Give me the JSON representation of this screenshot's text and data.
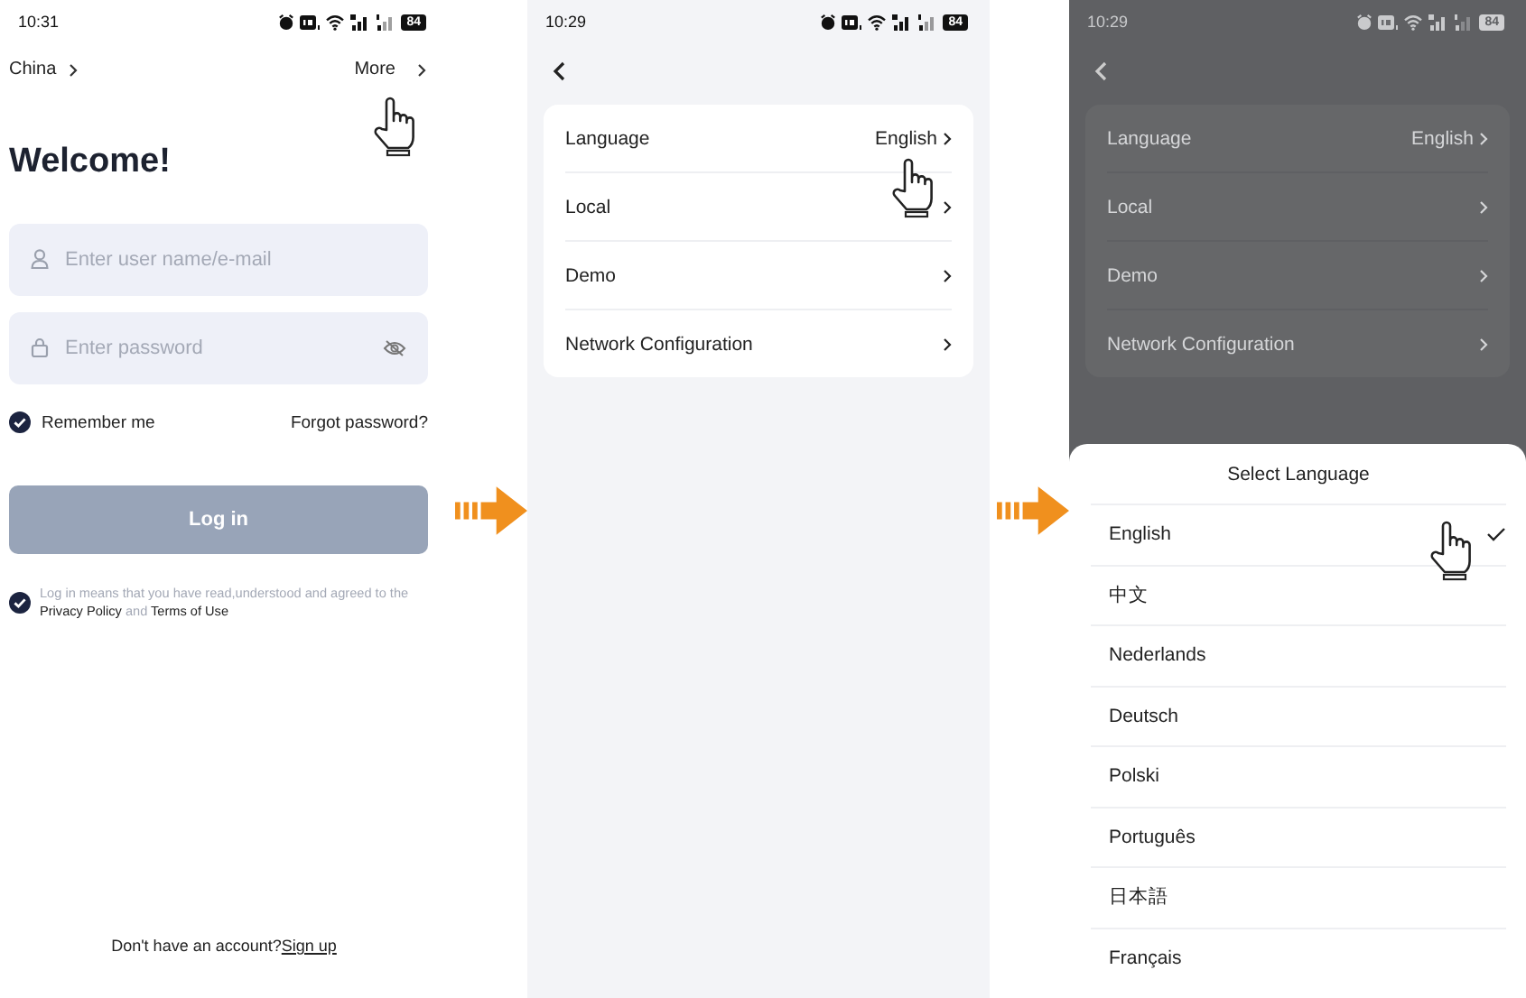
{
  "login_screen": {
    "status_bar": {
      "time": "10:31",
      "battery": "84"
    },
    "region": "China",
    "more": "More",
    "title": "Welcome!",
    "username_field": {
      "placeholder": "Enter user name/e-mail"
    },
    "password_field": {
      "placeholder": "Enter password"
    },
    "remember_me": {
      "label": "Remember me",
      "checked": true
    },
    "forgot_password": "Forgot password?",
    "login_button": "Log in",
    "agreement": {
      "checked": true,
      "text_before": "Log in means that you have read,understood and agreed to the ",
      "privacy_link": "Privacy Policy",
      "text_between": " and ",
      "terms_link": "Terms of Use"
    },
    "footer": {
      "text": "Don't have an account?",
      "link": "Sign up"
    }
  },
  "settings_screen": {
    "status_bar": {
      "time": "10:29",
      "battery": "84"
    },
    "items": [
      {
        "label": "Language",
        "value": "English"
      },
      {
        "label": "Local"
      },
      {
        "label": "Demo"
      },
      {
        "label": "Network Configuration"
      }
    ]
  },
  "language_screen": {
    "status_bar": {
      "time": "10:29",
      "battery": "84"
    },
    "items": [
      {
        "label": "Language",
        "value": "English"
      },
      {
        "label": "Local"
      },
      {
        "label": "Demo"
      },
      {
        "label": "Network Configuration"
      }
    ],
    "sheet": {
      "title": "Select Language",
      "options": [
        {
          "label": "English",
          "selected": true
        },
        {
          "label": "中文",
          "selected": false
        },
        {
          "label": "Nederlands",
          "selected": false
        },
        {
          "label": "Deutsch",
          "selected": false
        },
        {
          "label": "Polski",
          "selected": false
        },
        {
          "label": "Português",
          "selected": false
        },
        {
          "label": "日本語",
          "selected": false
        },
        {
          "label": "Français",
          "selected": false
        }
      ]
    }
  }
}
